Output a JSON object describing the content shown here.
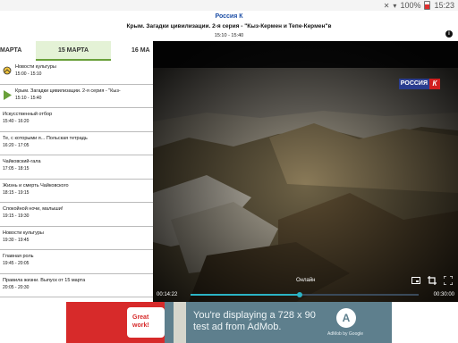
{
  "status_bar": {
    "battery": "100%",
    "time": "15:23"
  },
  "header": {
    "channel": "Россия К",
    "program_title": "Крым. Загадки цивилизации. 2-я серия - \"Кыз-Кермен и Тепе-Кермен\"в",
    "program_time": "15:10 - 15:40"
  },
  "tabs": [
    {
      "label": "МАРТА",
      "active": false
    },
    {
      "label": "15 МАРТА",
      "active": true
    },
    {
      "label": "16 МА",
      "active": false
    }
  ],
  "schedule": [
    {
      "title": "Новости культуры",
      "time": "15:00 - 15:10",
      "mark": "reminder"
    },
    {
      "title": "Крым. Загадки цивилизации. 2-я серия - \"Кыз-",
      "time": "15:10 - 15:40",
      "mark": "playing"
    },
    {
      "title": "Искусственный отбор",
      "time": "15:40 - 16:20"
    },
    {
      "title": "Те, с которыми я... Польская тетрадь",
      "time": "16:20 - 17:05"
    },
    {
      "title": "Чайковский-гала",
      "time": "17:05 - 18:15"
    },
    {
      "title": "Жизнь и смерть Чайковского",
      "time": "18:15 - 19:15"
    },
    {
      "title": "Спокойной ночи, малыши!",
      "time": "19:15 - 19:30"
    },
    {
      "title": "Новости культуры",
      "time": "19:30 - 19:45"
    },
    {
      "title": "Главная роль",
      "time": "19:45 - 20:05"
    },
    {
      "title": "Правила жизни. Выпуск от 15 марта",
      "time": "20:05 - 20:30"
    }
  ],
  "player": {
    "logo_text": "РОССИЯ",
    "logo_letter": "К",
    "live_label": "Онлайн",
    "current_time": "00:14:22",
    "end_time": "00:30:00",
    "progress": 0.48
  },
  "ad": {
    "badge": "Great work!",
    "text": "You're displaying a 728 x 90 test ad from AdMob.",
    "brand": "AdMob by Google",
    "logo_letter": "A"
  },
  "icons": {
    "mute": "mute-icon",
    "wifi": "wifi-icon",
    "battery": "battery-icon",
    "info": "info-icon",
    "aspect": "aspect-ratio-icon",
    "crop": "crop-icon",
    "fullscreen": "fullscreen-icon"
  }
}
